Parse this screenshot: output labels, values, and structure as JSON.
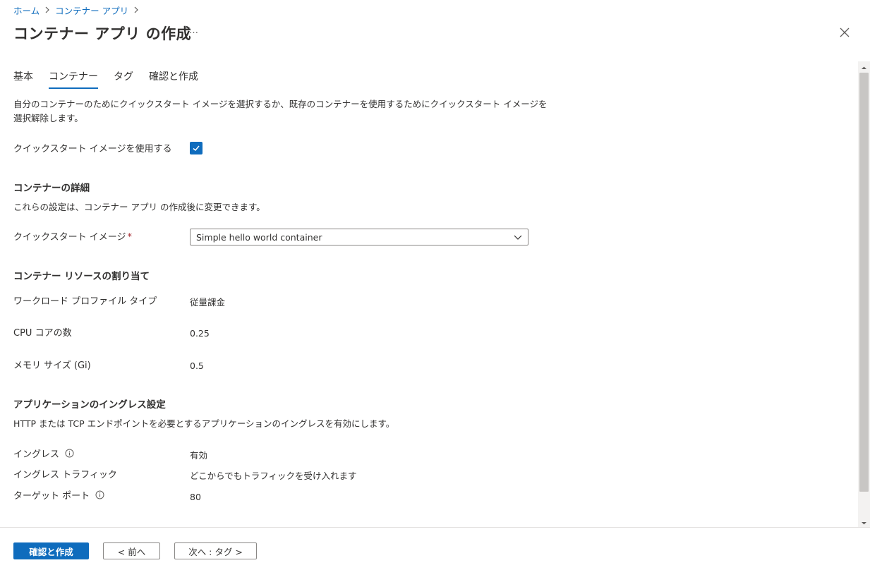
{
  "breadcrumb": {
    "home": "ホーム",
    "container_apps": "コンテナー アプリ"
  },
  "header": {
    "title": "コンテナー アプリ の作成",
    "more": "…"
  },
  "tabs": [
    {
      "label": "基本"
    },
    {
      "label": "コンテナー",
      "active": true
    },
    {
      "label": "タグ"
    },
    {
      "label": "確認と作成"
    }
  ],
  "intro": {
    "line1": "自分のコンテナーのためにクイックスタート イメージを選択するか、既存のコンテナーを使用するためにクイックスタート イメージを",
    "line2": "選択解除します。"
  },
  "quickstart": {
    "label": "クイックスタート イメージを使用する",
    "checked": true
  },
  "container_details": {
    "title": "コンテナーの詳細",
    "desc": "これらの設定は、コンテナー アプリ の作成後に変更できます。",
    "image_label": "クイックスタート イメージ",
    "required_mark": "*",
    "image_value": "Simple hello world container"
  },
  "resources": {
    "title": "コンテナー リソースの割り当て",
    "workload_label": "ワークロード プロファイル タイプ",
    "workload_value": "従量課金",
    "cpu_label": "CPU コアの数",
    "cpu_value": "0.25",
    "memory_label": "メモリ サイズ (Gi)",
    "memory_value": "0.5"
  },
  "ingress": {
    "title": "アプリケーションのイングレス設定",
    "desc": "HTTP または TCP エンドポイントを必要とするアプリケーションのイングレスを有効にします。",
    "ingress_label": "イングレス",
    "ingress_value": "有効",
    "traffic_label": "イングレス トラフィック",
    "traffic_value": "どこからでもトラフィックを受け入れます",
    "port_label": "ターゲット ポート",
    "port_value": "80"
  },
  "footer": {
    "review_create": "確認と作成",
    "prev": "< 前へ",
    "next": "次へ : タグ >"
  },
  "colors": {
    "accent": "#0f6cbd",
    "text": "#323130",
    "border": "#8a8886"
  }
}
